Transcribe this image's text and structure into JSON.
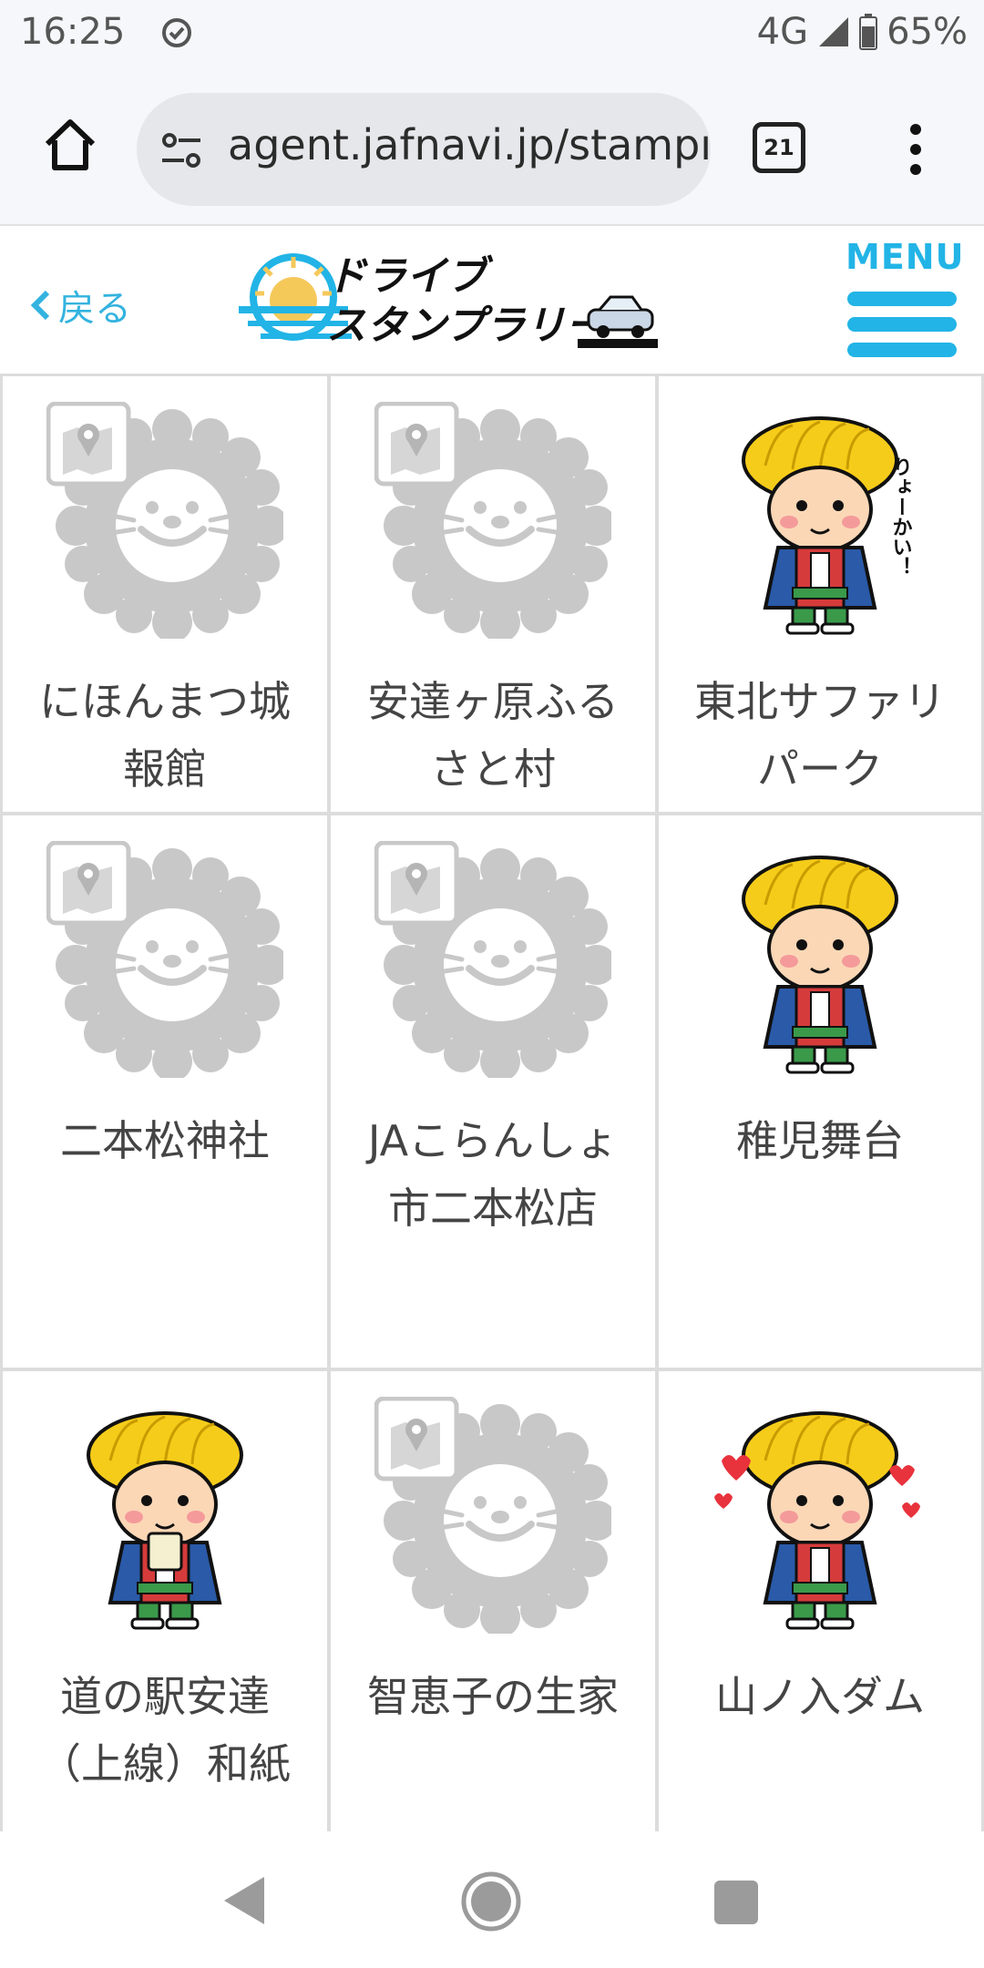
{
  "status": {
    "time": "16:25",
    "network": "4G",
    "battery": "65%"
  },
  "browser": {
    "url": "agent.jafnavi.jp/stampı",
    "tab_count": "21"
  },
  "header": {
    "back_label": "戻る",
    "logo_line1": "ドライブ",
    "logo_line2": "スタンプラリー",
    "menu_label": "MENU"
  },
  "spots": [
    {
      "label": "にほんまつ城報館",
      "stamp": "placeholder"
    },
    {
      "label": "安達ヶ原ふるさと村",
      "stamp": "placeholder"
    },
    {
      "label": "東北サファリパーク",
      "stamp": "character-salute"
    },
    {
      "label": "二本松神社",
      "stamp": "placeholder"
    },
    {
      "label": "JAこらんしょ市二本松店",
      "stamp": "placeholder"
    },
    {
      "label": "稚児舞台",
      "stamp": "character-wink"
    },
    {
      "label": "道の駅安達（上線）和紙",
      "stamp": "character-drink"
    },
    {
      "label": "智恵子の生家",
      "stamp": "placeholder"
    },
    {
      "label": "山ノ入ダム",
      "stamp": "character-hearts"
    }
  ],
  "salute_bubble": "りょーかい！",
  "colors": {
    "accent": "#22b4e6",
    "placeholder_gray": "#c8c8c8",
    "cell_border": "#dcdcdc"
  }
}
